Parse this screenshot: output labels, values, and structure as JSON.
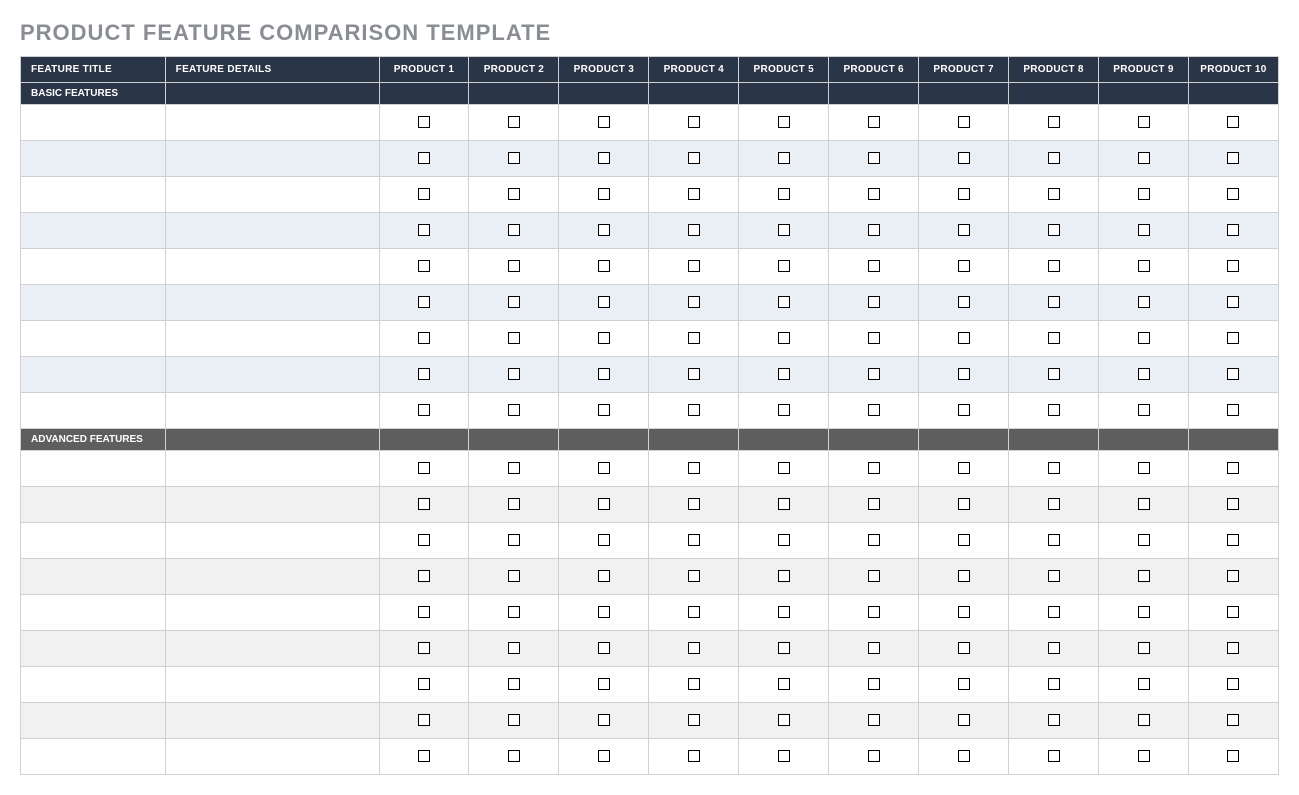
{
  "title": "PRODUCT FEATURE COMPARISON TEMPLATE",
  "headers": {
    "feature_title": "FEATURE TITLE",
    "feature_details": "FEATURE DETAILS",
    "products": [
      "PRODUCT 1",
      "PRODUCT 2",
      "PRODUCT 3",
      "PRODUCT 4",
      "PRODUCT 5",
      "PRODUCT 6",
      "PRODUCT 7",
      "PRODUCT 8",
      "PRODUCT 9",
      "PRODUCT 10"
    ]
  },
  "sections": [
    {
      "label": "BASIC FEATURES",
      "style": "basic",
      "rows": [
        {
          "title": "",
          "details": "",
          "checks": [
            false,
            false,
            false,
            false,
            false,
            false,
            false,
            false,
            false,
            false
          ]
        },
        {
          "title": "",
          "details": "",
          "checks": [
            false,
            false,
            false,
            false,
            false,
            false,
            false,
            false,
            false,
            false
          ]
        },
        {
          "title": "",
          "details": "",
          "checks": [
            false,
            false,
            false,
            false,
            false,
            false,
            false,
            false,
            false,
            false
          ]
        },
        {
          "title": "",
          "details": "",
          "checks": [
            false,
            false,
            false,
            false,
            false,
            false,
            false,
            false,
            false,
            false
          ]
        },
        {
          "title": "",
          "details": "",
          "checks": [
            false,
            false,
            false,
            false,
            false,
            false,
            false,
            false,
            false,
            false
          ]
        },
        {
          "title": "",
          "details": "",
          "checks": [
            false,
            false,
            false,
            false,
            false,
            false,
            false,
            false,
            false,
            false
          ]
        },
        {
          "title": "",
          "details": "",
          "checks": [
            false,
            false,
            false,
            false,
            false,
            false,
            false,
            false,
            false,
            false
          ]
        },
        {
          "title": "",
          "details": "",
          "checks": [
            false,
            false,
            false,
            false,
            false,
            false,
            false,
            false,
            false,
            false
          ]
        },
        {
          "title": "",
          "details": "",
          "checks": [
            false,
            false,
            false,
            false,
            false,
            false,
            false,
            false,
            false,
            false
          ]
        }
      ]
    },
    {
      "label": "ADVANCED FEATURES",
      "style": "advanced",
      "rows": [
        {
          "title": "",
          "details": "",
          "checks": [
            false,
            false,
            false,
            false,
            false,
            false,
            false,
            false,
            false,
            false
          ]
        },
        {
          "title": "",
          "details": "",
          "checks": [
            false,
            false,
            false,
            false,
            false,
            false,
            false,
            false,
            false,
            false
          ]
        },
        {
          "title": "",
          "details": "",
          "checks": [
            false,
            false,
            false,
            false,
            false,
            false,
            false,
            false,
            false,
            false
          ]
        },
        {
          "title": "",
          "details": "",
          "checks": [
            false,
            false,
            false,
            false,
            false,
            false,
            false,
            false,
            false,
            false
          ]
        },
        {
          "title": "",
          "details": "",
          "checks": [
            false,
            false,
            false,
            false,
            false,
            false,
            false,
            false,
            false,
            false
          ]
        },
        {
          "title": "",
          "details": "",
          "checks": [
            false,
            false,
            false,
            false,
            false,
            false,
            false,
            false,
            false,
            false
          ]
        },
        {
          "title": "",
          "details": "",
          "checks": [
            false,
            false,
            false,
            false,
            false,
            false,
            false,
            false,
            false,
            false
          ]
        },
        {
          "title": "",
          "details": "",
          "checks": [
            false,
            false,
            false,
            false,
            false,
            false,
            false,
            false,
            false,
            false
          ]
        },
        {
          "title": "",
          "details": "",
          "checks": [
            false,
            false,
            false,
            false,
            false,
            false,
            false,
            false,
            false,
            false
          ]
        }
      ]
    }
  ]
}
